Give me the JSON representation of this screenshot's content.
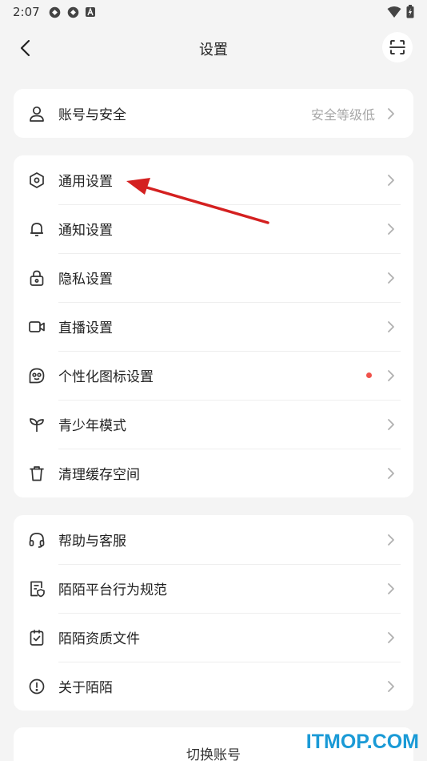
{
  "status": {
    "time": "2:07"
  },
  "nav": {
    "title": "设置"
  },
  "account_card": {
    "items": [
      {
        "label": "账号与安全",
        "value": "安全等级低",
        "icon": "person-icon"
      }
    ]
  },
  "settings_card": {
    "items": [
      {
        "label": "通用设置",
        "icon": "hexagon-settings-icon"
      },
      {
        "label": "通知设置",
        "icon": "bell-icon"
      },
      {
        "label": "隐私设置",
        "icon": "lock-icon"
      },
      {
        "label": "直播设置",
        "icon": "video-camera-icon"
      },
      {
        "label": "个性化图标设置",
        "icon": "face-icon"
      },
      {
        "label": "青少年模式",
        "icon": "sprout-icon"
      },
      {
        "label": "清理缓存空间",
        "icon": "trash-icon"
      }
    ]
  },
  "help_card": {
    "items": [
      {
        "label": "帮助与客服",
        "icon": "headset-icon"
      },
      {
        "label": "陌陌平台行为规范",
        "icon": "document-shield-icon"
      },
      {
        "label": "陌陌资质文件",
        "icon": "certificate-icon"
      },
      {
        "label": "关于陌陌",
        "icon": "info-icon"
      }
    ]
  },
  "switch_account": {
    "label": "切换账号"
  },
  "watermark": {
    "text": "ITMOP.COM",
    "color": "#1a9ad6"
  },
  "colors": {
    "badge_dot": "#f0524b",
    "annotation_arrow": "#d42020"
  }
}
